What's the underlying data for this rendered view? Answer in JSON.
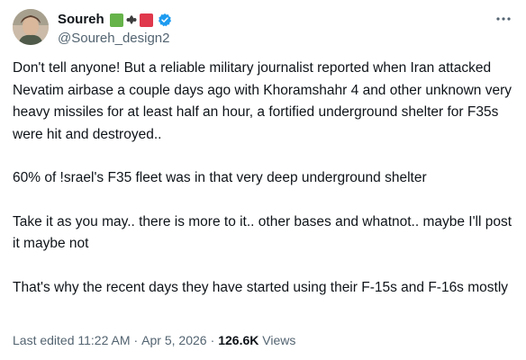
{
  "tweet": {
    "display_name": "Soureh",
    "handle": "@Soureh_design2",
    "paragraphs": [
      "Don't tell anyone! But a reliable military journalist reported when Iran attacked Nevatim airbase a couple days ago with Khoramshahr 4 and other unknown very heavy missiles for at least half an hour, a fortified underground shelter for F35s were hit and destroyed..",
      "60% of !srael's F35 fleet was in that very deep underground shelter",
      "Take it as you may.. there is more to it.. other bases and whatnot.. maybe I'll post it maybe not",
      "That's why the recent days they have started using their F-15s and F-16s mostly"
    ],
    "edited_label": "Last edited 11:22 AM",
    "separator": "·",
    "date": "Apr 5, 2026",
    "views_count": "126.6K",
    "views_label": "Views"
  },
  "icons": {
    "name_badges": [
      "green-flag-icon",
      "emblem-icon",
      "red-flag-icon"
    ],
    "verified": "verified-badge-icon",
    "more": "more-options-icon"
  },
  "colors": {
    "text_primary": "#0f1419",
    "text_secondary": "#536471",
    "verified_blue": "#1d9bf0",
    "flag_green": "#66b34a",
    "flag_red": "#e0384c"
  }
}
